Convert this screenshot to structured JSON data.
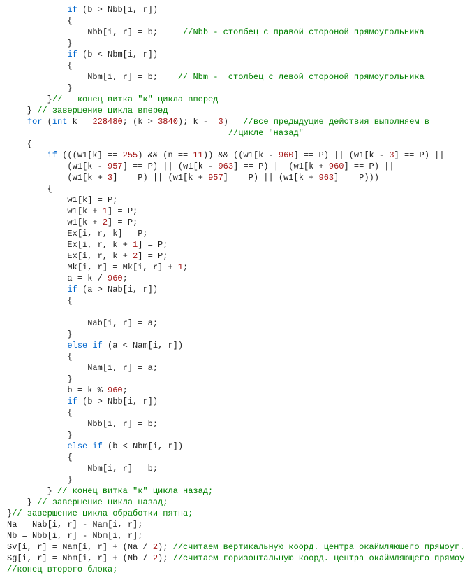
{
  "code": {
    "tokens": [
      [
        {
          "t": "            ",
          "c": "t"
        },
        {
          "t": "if",
          "c": "kw"
        },
        {
          "t": " (b > Nbb[i, r])",
          "c": "t"
        }
      ],
      [
        {
          "t": "            {",
          "c": "t"
        }
      ],
      [
        {
          "t": "                Nbb[i, r] = b;     ",
          "c": "t"
        },
        {
          "t": "//Nbb - столбец с правой стороной прямоугольника",
          "c": "cm"
        }
      ],
      [
        {
          "t": "            }",
          "c": "t"
        }
      ],
      [
        {
          "t": "            ",
          "c": "t"
        },
        {
          "t": "if",
          "c": "kw"
        },
        {
          "t": " (b < Nbm[i, r])",
          "c": "t"
        }
      ],
      [
        {
          "t": "            {",
          "c": "t"
        }
      ],
      [
        {
          "t": "                Nbm[i, r] = b;    ",
          "c": "t"
        },
        {
          "t": "// Nbm -  столбец с левой стороной прямоугольника",
          "c": "cm"
        }
      ],
      [
        {
          "t": "            }",
          "c": "t"
        }
      ],
      [
        {
          "t": "        }",
          "c": "t"
        },
        {
          "t": "//   конец витка \"к\" цикла вперед",
          "c": "cm"
        }
      ],
      [
        {
          "t": "    } ",
          "c": "t"
        },
        {
          "t": "// завершение цикла вперед",
          "c": "cm"
        }
      ],
      [
        {
          "t": "    ",
          "c": "t"
        },
        {
          "t": "for",
          "c": "kw"
        },
        {
          "t": " (",
          "c": "t"
        },
        {
          "t": "int",
          "c": "kw"
        },
        {
          "t": " k = ",
          "c": "t"
        },
        {
          "t": "228480",
          "c": "num"
        },
        {
          "t": "; (k > ",
          "c": "t"
        },
        {
          "t": "3840",
          "c": "num"
        },
        {
          "t": "); k -= ",
          "c": "t"
        },
        {
          "t": "3",
          "c": "num"
        },
        {
          "t": ")   ",
          "c": "t"
        },
        {
          "t": "//все предыдущие действия выполняем в",
          "c": "cm"
        }
      ],
      [
        {
          "t": "                                            ",
          "c": "t"
        },
        {
          "t": "//цикле \"назад\"",
          "c": "cm"
        }
      ],
      [
        {
          "t": "    {",
          "c": "t"
        }
      ],
      [
        {
          "t": "        ",
          "c": "t"
        },
        {
          "t": "if",
          "c": "kw"
        },
        {
          "t": " (((w1[k] == ",
          "c": "t"
        },
        {
          "t": "255",
          "c": "num"
        },
        {
          "t": ") && (n == ",
          "c": "t"
        },
        {
          "t": "11",
          "c": "num"
        },
        {
          "t": ")) && ((w1[k - ",
          "c": "t"
        },
        {
          "t": "960",
          "c": "num"
        },
        {
          "t": "] == P) || (w1[k - ",
          "c": "t"
        },
        {
          "t": "3",
          "c": "num"
        },
        {
          "t": "] == P) ||",
          "c": "t"
        }
      ],
      [
        {
          "t": "            (w1[k - ",
          "c": "t"
        },
        {
          "t": "957",
          "c": "num"
        },
        {
          "t": "] == P) || (w1[k - ",
          "c": "t"
        },
        {
          "t": "963",
          "c": "num"
        },
        {
          "t": "] == P) || (w1[k + ",
          "c": "t"
        },
        {
          "t": "960",
          "c": "num"
        },
        {
          "t": "] == P) ||",
          "c": "t"
        }
      ],
      [
        {
          "t": "            (w1[k + ",
          "c": "t"
        },
        {
          "t": "3",
          "c": "num"
        },
        {
          "t": "] == P) || (w1[k + ",
          "c": "t"
        },
        {
          "t": "957",
          "c": "num"
        },
        {
          "t": "] == P) || (w1[k + ",
          "c": "t"
        },
        {
          "t": "963",
          "c": "num"
        },
        {
          "t": "] == P)))",
          "c": "t"
        }
      ],
      [
        {
          "t": "        {",
          "c": "t"
        }
      ],
      [
        {
          "t": "            w1[k] = P;",
          "c": "t"
        }
      ],
      [
        {
          "t": "            w1[k + ",
          "c": "t"
        },
        {
          "t": "1",
          "c": "num"
        },
        {
          "t": "] = P;",
          "c": "t"
        }
      ],
      [
        {
          "t": "            w1[k + ",
          "c": "t"
        },
        {
          "t": "2",
          "c": "num"
        },
        {
          "t": "] = P;",
          "c": "t"
        }
      ],
      [
        {
          "t": "            Ex[i, r, k] = P;",
          "c": "t"
        }
      ],
      [
        {
          "t": "            Ex[i, r, k + ",
          "c": "t"
        },
        {
          "t": "1",
          "c": "num"
        },
        {
          "t": "] = P;",
          "c": "t"
        }
      ],
      [
        {
          "t": "            Ex[i, r, k + ",
          "c": "t"
        },
        {
          "t": "2",
          "c": "num"
        },
        {
          "t": "] = P;",
          "c": "t"
        }
      ],
      [
        {
          "t": "            Mk[i, r] = Mk[i, r] + ",
          "c": "t"
        },
        {
          "t": "1",
          "c": "num"
        },
        {
          "t": ";",
          "c": "t"
        }
      ],
      [
        {
          "t": "            a = k / ",
          "c": "t"
        },
        {
          "t": "960",
          "c": "num"
        },
        {
          "t": ";",
          "c": "t"
        }
      ],
      [
        {
          "t": "            ",
          "c": "t"
        },
        {
          "t": "if",
          "c": "kw"
        },
        {
          "t": " (a > Nab[i, r])",
          "c": "t"
        }
      ],
      [
        {
          "t": "            {",
          "c": "t"
        }
      ],
      [
        {
          "t": "",
          "c": "t"
        }
      ],
      [
        {
          "t": "                Nab[i, r] = a;",
          "c": "t"
        }
      ],
      [
        {
          "t": "            }",
          "c": "t"
        }
      ],
      [
        {
          "t": "            ",
          "c": "t"
        },
        {
          "t": "else if",
          "c": "kw"
        },
        {
          "t": " (a < Nam[i, r])",
          "c": "t"
        }
      ],
      [
        {
          "t": "            {",
          "c": "t"
        }
      ],
      [
        {
          "t": "                Nam[i, r] = a;",
          "c": "t"
        }
      ],
      [
        {
          "t": "            }",
          "c": "t"
        }
      ],
      [
        {
          "t": "            b = k % ",
          "c": "t"
        },
        {
          "t": "960",
          "c": "num"
        },
        {
          "t": ";",
          "c": "t"
        }
      ],
      [
        {
          "t": "            ",
          "c": "t"
        },
        {
          "t": "if",
          "c": "kw"
        },
        {
          "t": " (b > Nbb[i, r])",
          "c": "t"
        }
      ],
      [
        {
          "t": "            {",
          "c": "t"
        }
      ],
      [
        {
          "t": "                Nbb[i, r] = b;",
          "c": "t"
        }
      ],
      [
        {
          "t": "            }",
          "c": "t"
        }
      ],
      [
        {
          "t": "            ",
          "c": "t"
        },
        {
          "t": "else if",
          "c": "kw"
        },
        {
          "t": " (b < Nbm[i, r])",
          "c": "t"
        }
      ],
      [
        {
          "t": "            {",
          "c": "t"
        }
      ],
      [
        {
          "t": "                Nbm[i, r] = b;",
          "c": "t"
        }
      ],
      [
        {
          "t": "            }",
          "c": "t"
        }
      ],
      [
        {
          "t": "        } ",
          "c": "t"
        },
        {
          "t": "// конец витка \"к\" цикла назад;",
          "c": "cm"
        }
      ],
      [
        {
          "t": "    } ",
          "c": "t"
        },
        {
          "t": "// завершение цикла назад;",
          "c": "cm"
        }
      ],
      [
        {
          "t": "}",
          "c": "t"
        },
        {
          "t": "// завершение цикла обработки пятна;",
          "c": "cm"
        }
      ],
      [
        {
          "t": "Na = Nab[i, r] - Nam[i, r];",
          "c": "t"
        }
      ],
      [
        {
          "t": "Nb = Nbb[i, r] - Nbm[i, r];",
          "c": "t"
        }
      ],
      [
        {
          "t": "Sv[i, r] = Nam[i, r] + (Na / ",
          "c": "t"
        },
        {
          "t": "2",
          "c": "num"
        },
        {
          "t": "); ",
          "c": "t"
        },
        {
          "t": "//считаем вертикальную коорд. центра окаймляющего прямоуг.",
          "c": "cm"
        }
      ],
      [
        {
          "t": "Sg[i, r] = Nbm[i, r] + (Nb / ",
          "c": "t"
        },
        {
          "t": "2",
          "c": "num"
        },
        {
          "t": "); ",
          "c": "t"
        },
        {
          "t": "//считаем горизонтальную коорд. центра окаймляющего прямоуг.",
          "c": "cm"
        }
      ],
      [
        {
          "t": "//конец второго блока;",
          "c": "cm"
        }
      ]
    ]
  }
}
